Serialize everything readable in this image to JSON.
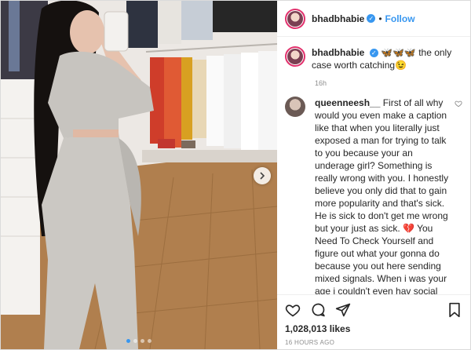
{
  "header": {
    "username": "bhadbhabie",
    "verified_glyph": "✓",
    "separator": "•",
    "follow_label": "Follow"
  },
  "caption": {
    "username": "bhadbhabie",
    "emoji_prefix": "🦋🦋🦋",
    "text": " the only case worth catching😉",
    "time": "16h"
  },
  "comment": {
    "username": "queenneesh__",
    "text": "First of all why would you even make a caption like that when you literally just exposed a man for trying to talk to you because your an underage girl? Something is really wrong with you. I honestly believe you only did that to gain more popularity and that's sick. He is sick to don't get me wrong but your just as sick. 💔 You Need To Check Yourself and figure out what your gonna do because you out here sending mixed signals. When i was your age i couldn't even hav social media nor could i wear half the things that you are wearing. This shit is just sad"
  },
  "footer": {
    "likes": "1,028,013 likes",
    "posted": "16 HOURS AGO"
  },
  "icons": {
    "like": "heart-icon",
    "comment": "comment-icon",
    "share": "share-icon",
    "save": "bookmark-icon",
    "next": "chevron-right-icon"
  },
  "carousel": {
    "count": 4,
    "active": 0
  },
  "colors": {
    "accent": "#3897f0",
    "text": "#262626",
    "muted": "#8e8e8e"
  }
}
